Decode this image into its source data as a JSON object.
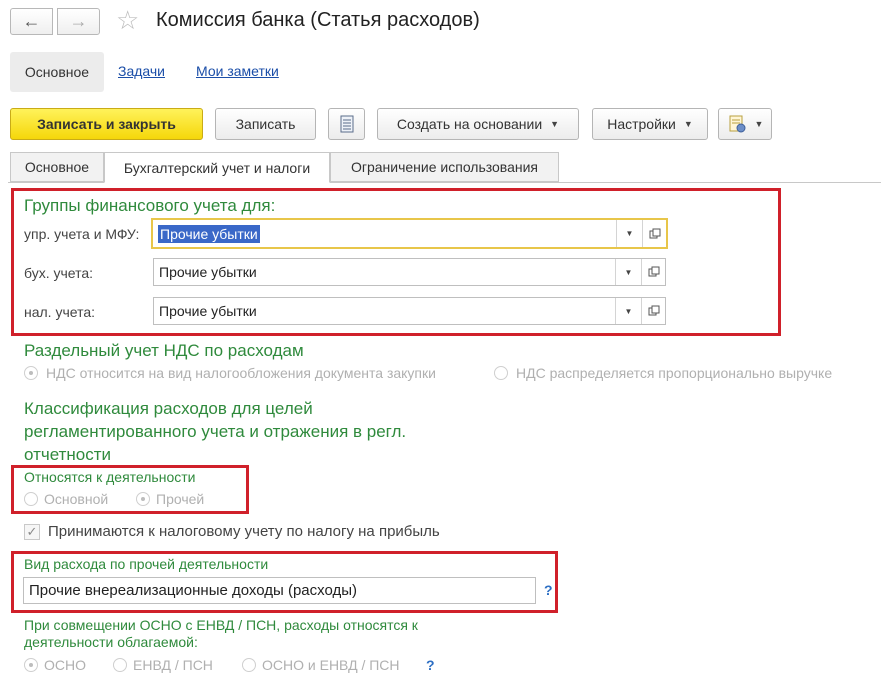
{
  "window": {
    "title": "Комиссия банка (Статья расходов)"
  },
  "sections": [
    {
      "label": "Основное"
    },
    {
      "label": "Задачи"
    },
    {
      "label": "Мои заметки"
    }
  ],
  "toolbar": {
    "save_close": "Записать и закрыть",
    "save": "Записать",
    "create_based": "Создать на основании",
    "settings": "Настройки"
  },
  "tabs": [
    {
      "label": "Основное"
    },
    {
      "label": "Бухгалтерский учет и налоги"
    },
    {
      "label": "Ограничение использования"
    }
  ],
  "fin_groups": {
    "title": "Группы финансового учета для:",
    "rows": [
      {
        "label": "упр. учета и МФУ:",
        "value": "Прочие убытки"
      },
      {
        "label": "бух. учета:",
        "value": "Прочие убытки"
      },
      {
        "label": "нал. учета:",
        "value": "Прочие убытки"
      }
    ]
  },
  "vat": {
    "title": "Раздельный учет НДС по расходам",
    "option1": "НДС относится на вид налогообложения документа закупки",
    "option2": "НДС распределяется пропорционально выручке"
  },
  "classification": {
    "title_line1": "Классификация расходов для целей",
    "title_line2": "регламентированного учета и отражения в регл.",
    "title_line3": "отчетности"
  },
  "activity": {
    "label": "Относятся к деятельности",
    "option1": "Основной",
    "option2": "Прочей"
  },
  "profit_tax": {
    "label": "Принимаются к налоговому учету по налогу на прибыль"
  },
  "other_expense": {
    "label": "Вид расхода по прочей деятельности",
    "value": "Прочие внереализационные доходы (расходы)",
    "help": "?"
  },
  "combo": {
    "label_line1": "При совмещении ОСНО с ЕНВД / ПСН, расходы относятся к",
    "label_line2": "деятельности облагаемой:",
    "option1": "ОСНО",
    "option2": "ЕНВД / ПСН",
    "option3": "ОСНО и ЕНВД / ПСН",
    "help": "?"
  }
}
